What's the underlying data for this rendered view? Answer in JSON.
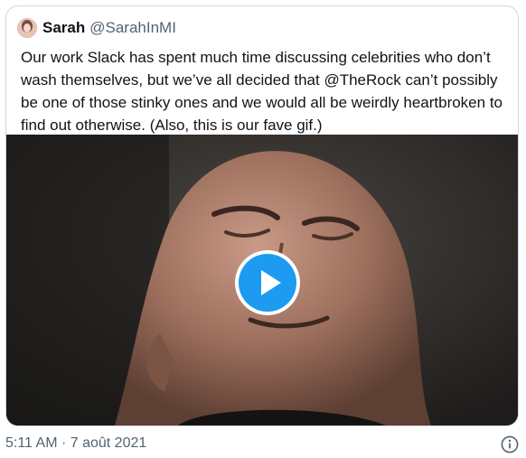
{
  "tweet": {
    "display_name": "Sarah",
    "handle": "@SarahInMI",
    "text": "Our work Slack has spent much time discussing celebrities who don’t wash themselves, but we’ve all decided that @TheRock can’t possibly be one of those stinky ones and we would all be weirdly heartbroken to find out otherwise. (Also, this is our fave gif.)",
    "media_type": "gif",
    "play_icon": "play-icon",
    "timestamp": "5:11 AM · 7 août 2021",
    "info_icon": "info-icon"
  },
  "colors": {
    "accent": "#1d9bf0",
    "text": "#0f1419",
    "secondary_text": "#536471",
    "border": "#cfd9de"
  }
}
